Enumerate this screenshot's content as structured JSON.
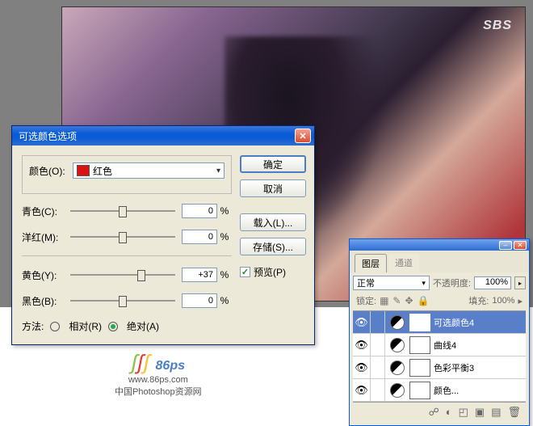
{
  "photo": {
    "watermark": "SBS"
  },
  "dialog": {
    "title": "可选颜色选项",
    "color_label": "颜色(O):",
    "color_value": "红色",
    "sliders": [
      {
        "label": "青色(C):",
        "value": "0",
        "thumb_pct": 50
      },
      {
        "label": "洋红(M):",
        "value": "0",
        "thumb_pct": 50
      },
      {
        "label": "黄色(Y):",
        "value": "+37",
        "thumb_pct": 68
      },
      {
        "label": "黑色(B):",
        "value": "0",
        "thumb_pct": 50
      }
    ],
    "method_label": "方法:",
    "method_rel": "相对(R)",
    "method_abs": "绝对(A)",
    "buttons": {
      "ok": "确定",
      "cancel": "取消",
      "load": "载入(L)...",
      "save": "存储(S)..."
    },
    "preview": "预览(P)"
  },
  "panel": {
    "tabs": {
      "layers": "图层",
      "channels": "通道"
    },
    "blend_mode": "正常",
    "opacity_label": "不透明度:",
    "opacity_value": "100%",
    "lock_label": "锁定:",
    "fill_label": "填充:",
    "fill_value": "100%",
    "layers": [
      {
        "name": "可选颜色4",
        "selected": true
      },
      {
        "name": "曲线4",
        "selected": false
      },
      {
        "name": "色彩平衡3",
        "selected": false
      },
      {
        "name": "颜色...",
        "selected": false
      }
    ]
  },
  "logo": {
    "url": "www.86ps.com",
    "tagline": "中国Photoshop资源网",
    "brand": "86ps"
  }
}
